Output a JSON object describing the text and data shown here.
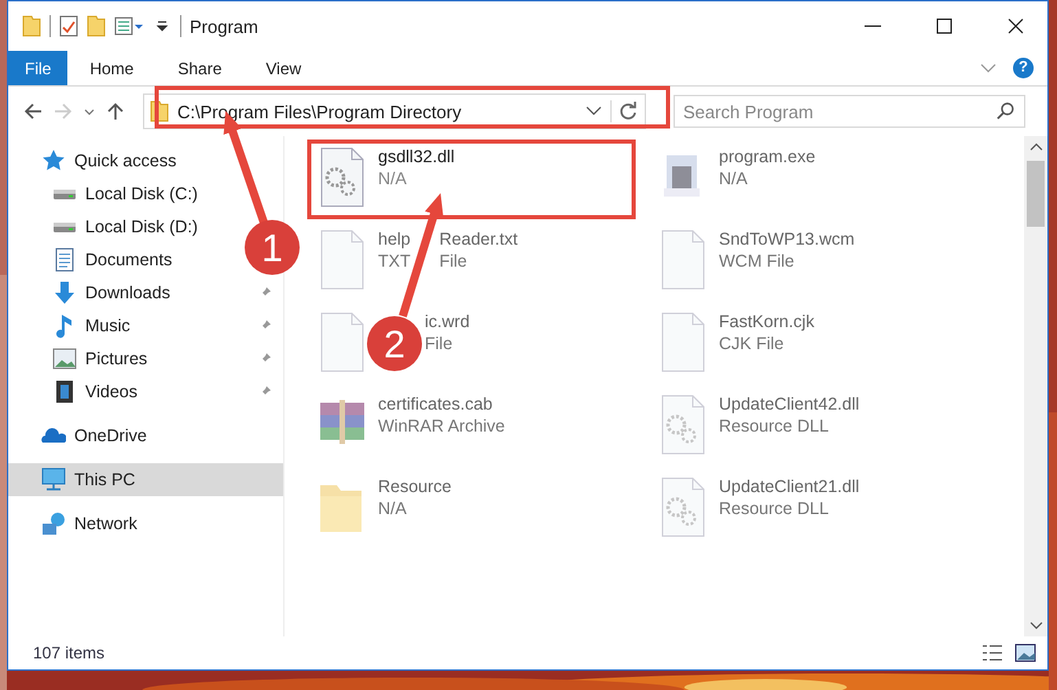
{
  "window": {
    "title": "Program"
  },
  "ribbon": {
    "tabs": [
      {
        "label": "File",
        "selected": true
      },
      {
        "label": "Home",
        "selected": false
      },
      {
        "label": "Share",
        "selected": false
      },
      {
        "label": "View",
        "selected": false
      }
    ],
    "help": "?"
  },
  "address_bar": {
    "path": "C:\\Program Files\\Program Directory"
  },
  "search": {
    "placeholder": "Search Program"
  },
  "sidebar": {
    "items": [
      {
        "label": "Quick access",
        "kind": "star",
        "selected": false,
        "children": [
          {
            "label": "Local Disk (C:)",
            "kind": "disk",
            "pinned": false,
            "selected": false
          },
          {
            "label": "Local Disk (D:)",
            "kind": "disk",
            "pinned": false,
            "selected": false
          },
          {
            "label": "Documents",
            "kind": "doc",
            "pinned": false,
            "selected": false
          },
          {
            "label": "Downloads",
            "kind": "download",
            "pinned": true,
            "selected": false
          },
          {
            "label": "Music",
            "kind": "music",
            "pinned": true,
            "selected": false
          },
          {
            "label": "Pictures",
            "kind": "pictures",
            "pinned": true,
            "selected": false
          },
          {
            "label": "Videos",
            "kind": "videos",
            "pinned": true,
            "selected": false
          }
        ]
      },
      {
        "label": "OneDrive",
        "kind": "cloud",
        "selected": false
      },
      {
        "label": "This PC",
        "kind": "pc",
        "selected": true
      },
      {
        "label": "Network",
        "kind": "network",
        "selected": false
      }
    ]
  },
  "files": [
    {
      "name_parts": [
        "gsdll32.dll"
      ],
      "type_parts": [
        "N/A"
      ],
      "kind": "gears",
      "faded": false
    },
    {
      "name_parts": [
        "program.exe"
      ],
      "type_parts": [
        "N/A"
      ],
      "kind": "exe",
      "faded": true
    },
    {
      "name_parts": [
        "help",
        "Reader.txt"
      ],
      "type_parts": [
        "TXT",
        "File"
      ],
      "kind": "blank",
      "faded": true
    },
    {
      "name_parts": [
        "SndToWP13.wcm"
      ],
      "type_parts": [
        "WCM File"
      ],
      "kind": "blank",
      "faded": true
    },
    {
      "name_parts": [
        "ic.wrd"
      ],
      "type_parts": [
        "File"
      ],
      "kind": "blank",
      "faded": true,
      "under_badge": true
    },
    {
      "name_parts": [
        "FastKorn.cjk"
      ],
      "type_parts": [
        "CJK File"
      ],
      "kind": "blank",
      "faded": true
    },
    {
      "name_parts": [
        "certificates.cab"
      ],
      "type_parts": [
        "WinRAR Archive"
      ],
      "kind": "archive",
      "faded": true
    },
    {
      "name_parts": [
        "UpdateClient42.dll"
      ],
      "type_parts": [
        "Resource DLL"
      ],
      "kind": "gears",
      "faded": true
    },
    {
      "name_parts": [
        "Resource"
      ],
      "type_parts": [
        "N/A"
      ],
      "kind": "folder",
      "faded": true
    },
    {
      "name_parts": [
        "UpdateClient21.dll"
      ],
      "type_parts": [
        "Resource DLL"
      ],
      "kind": "gears",
      "faded": true
    }
  ],
  "status_bar": {
    "count": "107 items"
  },
  "annotations": [
    {
      "number": "1"
    },
    {
      "number": "2"
    }
  ]
}
